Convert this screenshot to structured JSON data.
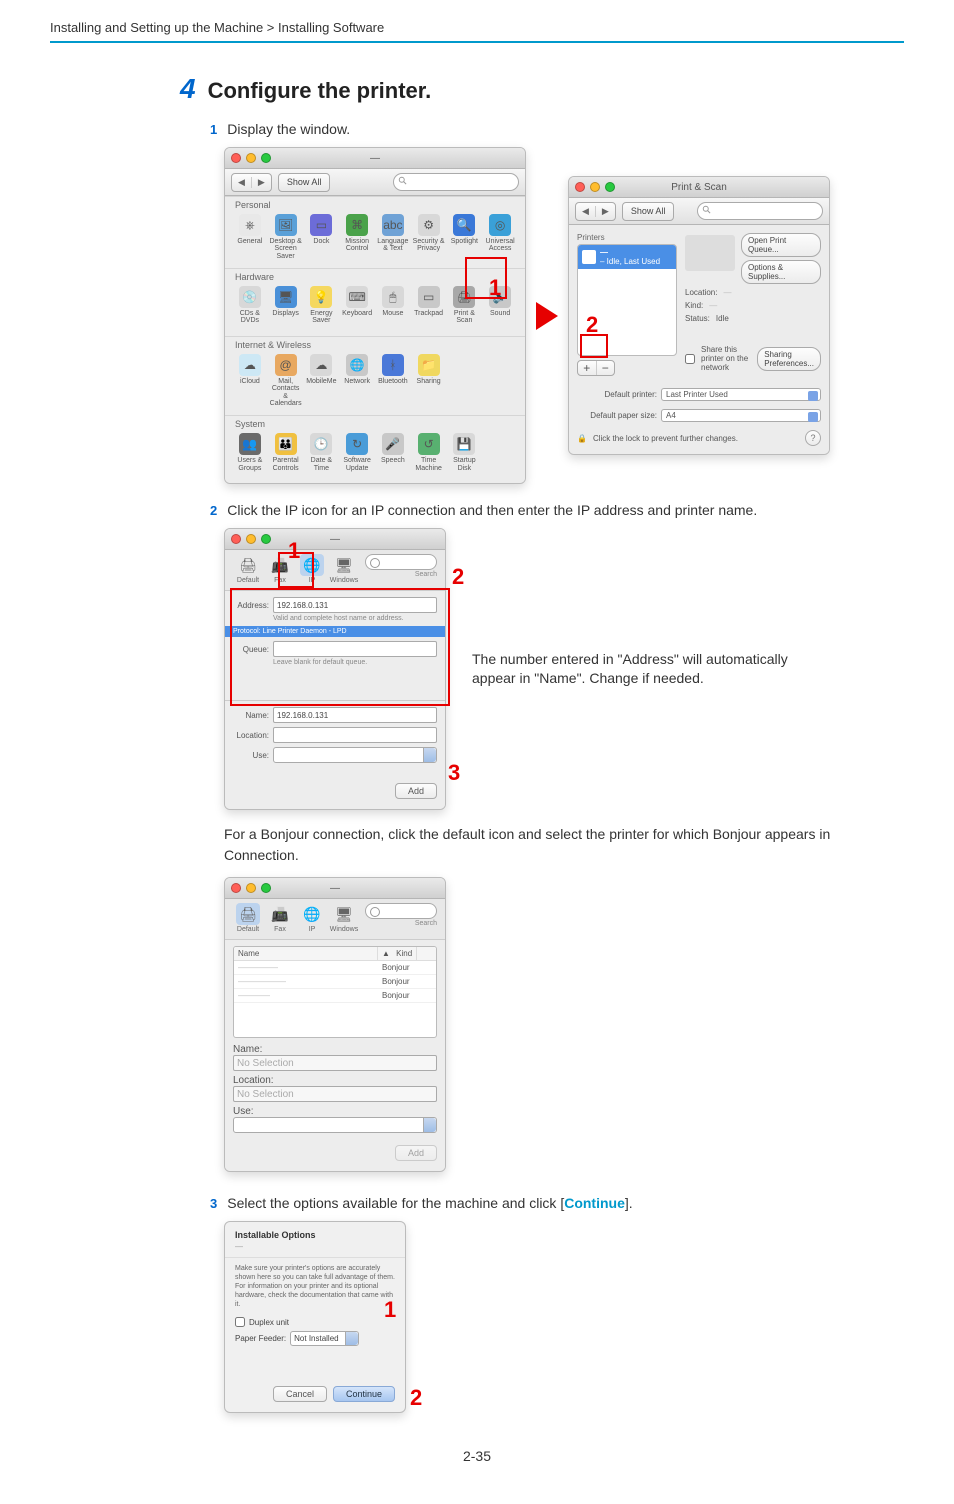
{
  "breadcrumb": "Installing and Setting up the Machine > Installing Software",
  "section": {
    "number": "4",
    "title": "Configure the printer."
  },
  "step1": {
    "num": "1",
    "text": "Display the window."
  },
  "step2": {
    "num": "2",
    "text": "Click the IP icon for an IP connection and then enter the IP address and printer name."
  },
  "annotation2": "The number entered in \"Address\" will automatically appear in \"Name\". Change if needed.",
  "bonjour_text": "For a Bonjour connection, click the default icon and select the printer for which Bonjour appears in Connection.",
  "step3_prefix": "Select the options available for the machine and click [",
  "step3_link": "Continue",
  "step3_suffix": "].",
  "step3_num": "3",
  "page_number": "2-35",
  "sysprefs": {
    "show_all": "Show All",
    "groups": [
      {
        "title": "Personal",
        "items": [
          {
            "label": "General",
            "bg": "#e8e8e8",
            "glyph": "⎈"
          },
          {
            "label": "Desktop & Screen Saver",
            "bg": "#5aa0d8",
            "glyph": "🖼"
          },
          {
            "label": "Dock",
            "bg": "#6c6cd8",
            "glyph": "▭"
          },
          {
            "label": "Mission Control",
            "bg": "#4aa24a",
            "glyph": "⌘"
          },
          {
            "label": "Language & Text",
            "bg": "#6fa2d6",
            "glyph": "abc"
          },
          {
            "label": "Security & Privacy",
            "bg": "#d8d8d8",
            "glyph": "⚙"
          },
          {
            "label": "Spotlight",
            "bg": "#3a78d8",
            "glyph": "🔍"
          },
          {
            "label": "Universal Access",
            "bg": "#3aa0d8",
            "glyph": "◎"
          }
        ]
      },
      {
        "title": "Hardware",
        "items": [
          {
            "label": "CDs & DVDs",
            "bg": "#d8d8d8",
            "glyph": "💿"
          },
          {
            "label": "Displays",
            "bg": "#4a90d8",
            "glyph": "🖥"
          },
          {
            "label": "Energy Saver",
            "bg": "#f5d860",
            "glyph": "💡"
          },
          {
            "label": "Keyboard",
            "bg": "#d8d8d8",
            "glyph": "⌨"
          },
          {
            "label": "Mouse",
            "bg": "#d8d8d8",
            "glyph": "🖱"
          },
          {
            "label": "Trackpad",
            "bg": "#c8c8c8",
            "glyph": "▭"
          },
          {
            "label": "Print & Scan",
            "bg": "#a8a8a8",
            "glyph": "🖨"
          },
          {
            "label": "Sound",
            "bg": "#c8c8c8",
            "glyph": "🔈"
          }
        ]
      },
      {
        "title": "Internet & Wireless",
        "items": [
          {
            "label": "iCloud",
            "bg": "#cde8f5",
            "glyph": "☁"
          },
          {
            "label": "Mail, Contacts & Calendars",
            "bg": "#e8a860",
            "glyph": "@"
          },
          {
            "label": "MobileMe",
            "bg": "#d8d8d8",
            "glyph": "☁"
          },
          {
            "label": "Network",
            "bg": "#c8c8c8",
            "glyph": "🌐"
          },
          {
            "label": "Bluetooth",
            "bg": "#4a78d8",
            "glyph": "ᚼ"
          },
          {
            "label": "Sharing",
            "bg": "#f0d860",
            "glyph": "📁"
          }
        ]
      },
      {
        "title": "System",
        "items": [
          {
            "label": "Users & Groups",
            "bg": "#6a6a6a",
            "glyph": "👥"
          },
          {
            "label": "Parental Controls",
            "bg": "#f0c040",
            "glyph": "👪"
          },
          {
            "label": "Date & Time",
            "bg": "#d8d8d8",
            "glyph": "🕒"
          },
          {
            "label": "Software Update",
            "bg": "#4a9cd8",
            "glyph": "↻"
          },
          {
            "label": "Speech",
            "bg": "#c8c8c8",
            "glyph": "🎤"
          },
          {
            "label": "Time Machine",
            "bg": "#58b070",
            "glyph": "↺"
          },
          {
            "label": "Startup Disk",
            "bg": "#d8d8d8",
            "glyph": "💾"
          }
        ]
      }
    ]
  },
  "printscan": {
    "title": "Print & Scan",
    "show_all": "Show All",
    "printers_label": "Printers",
    "printer_row1": "– Idle, Last Used",
    "open_queue": "Open Print Queue...",
    "options_supplies": "Options & Supplies...",
    "location_label": "Location:",
    "kind_label": "Kind:",
    "status_label": "Status:",
    "status_value": "Idle",
    "share_label": "Share this printer on the network",
    "sharing_prefs": "Sharing Preferences...",
    "default_printer_label": "Default printer:",
    "default_printer_value": "Last Printer Used",
    "default_paper_label": "Default paper size:",
    "default_paper_value": "A4",
    "lock_text": "Click the lock to prevent further changes."
  },
  "addprinter_ip": {
    "modes": [
      {
        "label": "Default",
        "glyph": "🖨"
      },
      {
        "label": "Fax",
        "glyph": "📠"
      },
      {
        "label": "IP",
        "glyph": "🌐"
      },
      {
        "label": "Windows",
        "glyph": "🖥"
      }
    ],
    "search_label": "Search",
    "address_label": "Address:",
    "address_value": "192.168.0.131",
    "address_hint": "Valid and complete host name or address.",
    "protocol_bar": "Protocol:   Line Printer Daemon - LPD",
    "queue_label": "Queue:",
    "queue_hint": "Leave blank for default queue.",
    "name_label": "Name:",
    "name_value": "192.168.0.131",
    "location_label": "Location:",
    "use_label": "Use:",
    "add_button": "Add"
  },
  "addprinter_bonjour": {
    "modes": [
      {
        "label": "Default",
        "glyph": "🖨"
      },
      {
        "label": "Fax",
        "glyph": "📠"
      },
      {
        "label": "IP",
        "glyph": "🌐"
      },
      {
        "label": "Windows",
        "glyph": "🖥"
      }
    ],
    "search_label": "Search",
    "col_name": "Name",
    "col_kind": "Kind",
    "rows": [
      {
        "name": "—————",
        "kind": "Bonjour"
      },
      {
        "name": "——————",
        "kind": "Bonjour"
      },
      {
        "name": "————",
        "kind": "Bonjour"
      }
    ],
    "name_label": "Name:",
    "name_value": "No Selection",
    "location_label": "Location:",
    "location_value": "No Selection",
    "use_label": "Use:",
    "add_button": "Add"
  },
  "installable": {
    "title": "Installable Options",
    "desc": "Make sure your printer's options are accurately shown here so you can take full advantage of them. For information on your printer and its optional hardware, check the documentation that came with it.",
    "duplex_label": "Duplex unit",
    "paper_feeder_label": "Paper Feeder:",
    "paper_feeder_value": "Not Installed",
    "cancel": "Cancel",
    "continue": "Continue"
  }
}
